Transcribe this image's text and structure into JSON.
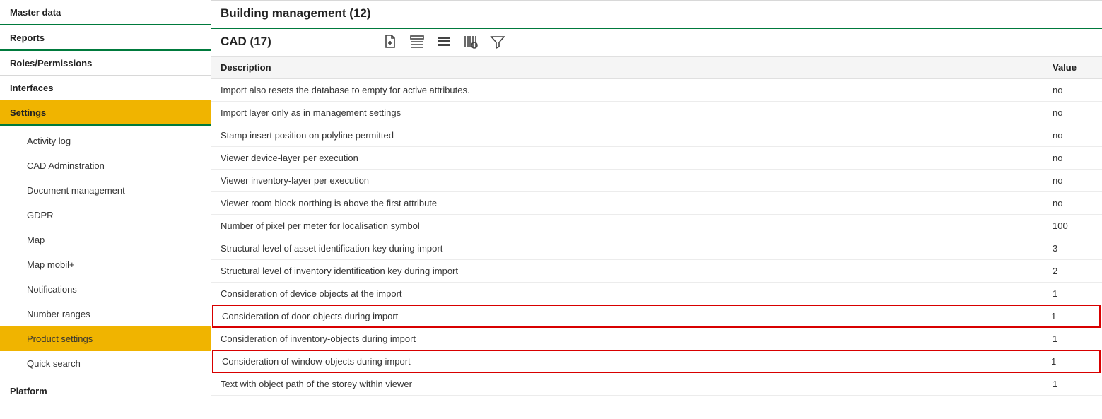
{
  "sidebar": {
    "top": [
      {
        "label": "Master data",
        "green": true
      },
      {
        "label": "Reports",
        "green": true
      },
      {
        "label": "Roles/Permissions",
        "green": false
      },
      {
        "label": "Interfaces",
        "green": false
      },
      {
        "label": "Settings",
        "green": true,
        "active": true
      }
    ],
    "sub": [
      {
        "label": "Activity log"
      },
      {
        "label": "CAD Adminstration"
      },
      {
        "label": "Document management"
      },
      {
        "label": "GDPR"
      },
      {
        "label": "Map"
      },
      {
        "label": "Map mobil+"
      },
      {
        "label": "Notifications"
      },
      {
        "label": "Number ranges"
      },
      {
        "label": "Product settings",
        "active": true
      },
      {
        "label": "Quick search"
      }
    ],
    "bottom": "Platform"
  },
  "header": {
    "title": "Building management (12)"
  },
  "toolbar": {
    "title": "CAD (17)"
  },
  "table": {
    "columns": {
      "description": "Description",
      "value": "Value"
    },
    "rows": [
      {
        "desc": "Import also resets the database to empty for active attributes.",
        "val": "no"
      },
      {
        "desc": "Import layer only as in management settings",
        "val": "no"
      },
      {
        "desc": "Stamp insert position on polyline permitted",
        "val": "no"
      },
      {
        "desc": "Viewer device-layer per execution",
        "val": "no"
      },
      {
        "desc": "Viewer inventory-layer per execution",
        "val": "no"
      },
      {
        "desc": "Viewer room block northing is above the first attribute",
        "val": "no"
      },
      {
        "desc": "Number of pixel per meter for localisation symbol",
        "val": "100"
      },
      {
        "desc": "Structural level of asset identification key during import",
        "val": "3"
      },
      {
        "desc": "Structural level of inventory identification key during import",
        "val": "2"
      },
      {
        "desc": "Consideration of device objects at the import",
        "val": "1"
      },
      {
        "desc": "Consideration of door-objects during import",
        "val": "1",
        "highlight": true
      },
      {
        "desc": "Consideration of inventory-objects during import",
        "val": "1"
      },
      {
        "desc": "Consideration of window-objects during import",
        "val": "1",
        "highlight": true
      },
      {
        "desc": "Text with object path of the storey within viewer",
        "val": "1"
      }
    ]
  }
}
